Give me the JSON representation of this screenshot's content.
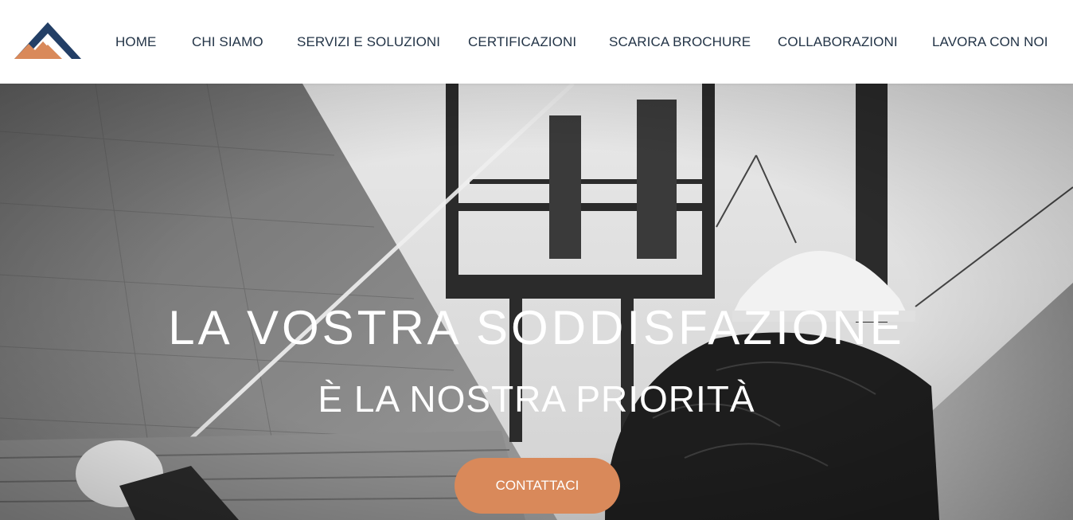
{
  "brand": {
    "logo_icon": "mountain-logo-icon",
    "colors": {
      "navy": "#233f66",
      "orange": "#d9895a",
      "nav_text": "#233447"
    }
  },
  "nav": {
    "items": [
      {
        "label": "HOME"
      },
      {
        "label": "CHI SIAMO"
      },
      {
        "label": "SERVIZI E SOLUZIONI"
      },
      {
        "label": "CERTIFICAZIONI"
      },
      {
        "label": "SCARICA BROCHURE"
      },
      {
        "label": "COLLABORAZIONI"
      },
      {
        "label": "LAVORA CON NOI"
      }
    ]
  },
  "hero": {
    "headline": "LA VOSTRA SODDISFAZIONE",
    "subline": "È LA NOSTRA PRIORITÀ",
    "cta_label": "CONTATTACI",
    "cta_color": "#d9895a"
  }
}
